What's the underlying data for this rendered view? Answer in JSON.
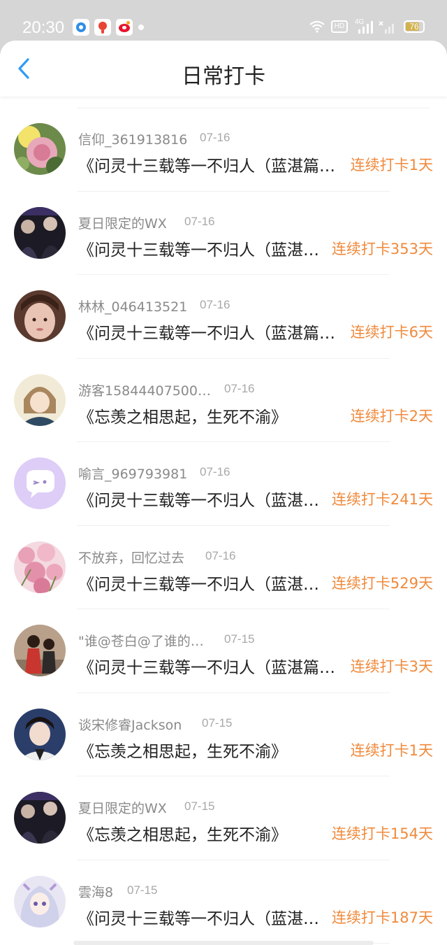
{
  "status_bar": {
    "time": "20:30",
    "icons": [
      "message-app-icon",
      "map-app-icon",
      "weibo-icon",
      "notification-dot-icon",
      "wifi-icon",
      "hd-icon",
      "4g-signal-icon",
      "no-signal-icon"
    ],
    "hd_label": "HD",
    "network_label": "4G",
    "battery": "76"
  },
  "header": {
    "title": "日常打卡",
    "back_icon": "chevron-left-icon"
  },
  "colors": {
    "accent_blue": "#2f9cf5",
    "streak_orange": "#f08a3c",
    "muted_text": "#8a8a8a"
  },
  "checkins": [
    {
      "user": "信仰_361913816",
      "date": "07-16",
      "title": "《问灵十三载等一不归人（蓝湛篇…",
      "streak": "连续打卡1天"
    },
    {
      "user": "夏日限定的WX",
      "date": "07-16",
      "title": "《问灵十三载等一不归人（蓝湛…",
      "streak": "连续打卡353天"
    },
    {
      "user": "林林_046413521",
      "date": "07-16",
      "title": "《问灵十三载等一不归人（蓝湛篇…",
      "streak": "连续打卡6天"
    },
    {
      "user": "游客15844407500…",
      "date": "07-16",
      "title": "《忘羡之相思起，生死不渝》",
      "streak": "连续打卡2天"
    },
    {
      "user": "喻言_969793981",
      "date": "07-16",
      "title": "《问灵十三载等一不归人（蓝湛…",
      "streak": "连续打卡241天"
    },
    {
      "user": "不放弃，回忆过去",
      "date": "07-16",
      "title": "《问灵十三载等一不归人（蓝湛…",
      "streak": "连续打卡529天"
    },
    {
      "user": "\"谁@苍白@了谁的…",
      "date": "07-15",
      "title": "《问灵十三载等一不归人（蓝湛篇…",
      "streak": "连续打卡3天"
    },
    {
      "user": "谈宋修睿Jackson",
      "date": "07-15",
      "title": "《忘羡之相思起，生死不渝》",
      "streak": "连续打卡1天"
    },
    {
      "user": "夏日限定的WX",
      "date": "07-15",
      "title": "《忘羡之相思起，生死不渝》",
      "streak": "连续打卡154天"
    },
    {
      "user": "雲海8",
      "date": "07-15",
      "title": "《问灵十三载等一不归人（蓝湛…",
      "streak": "连续打卡187天"
    }
  ]
}
